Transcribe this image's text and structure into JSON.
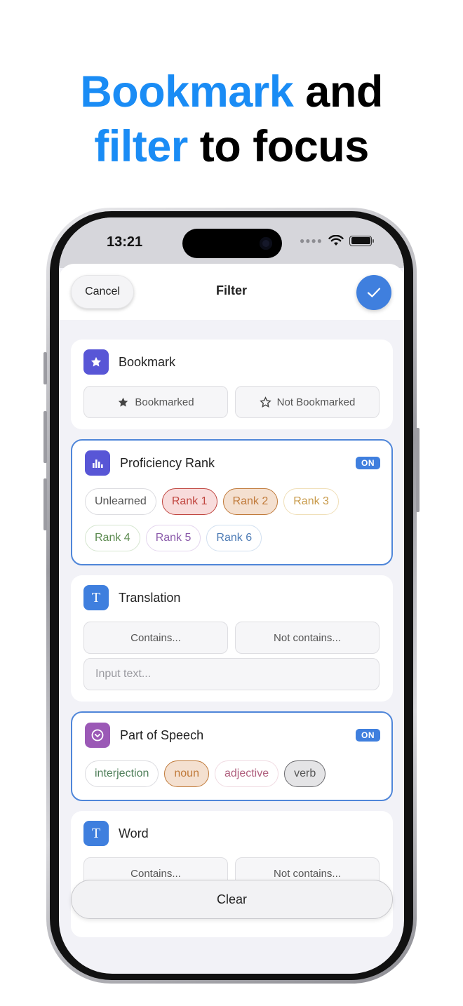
{
  "headline": {
    "line1_accent": "Bookmark",
    "line1_rest": " and",
    "line2_accent": "filter",
    "line2_rest": " to focus",
    "accent_color": "#1a8cf5"
  },
  "status_bar": {
    "time": "13:21",
    "icons": [
      "cellular-dots-icon",
      "wifi-icon",
      "battery-icon"
    ]
  },
  "header": {
    "cancel_label": "Cancel",
    "title": "Filter",
    "confirm_icon": "checkmark-icon"
  },
  "bookmark": {
    "title": "Bookmark",
    "icon": "star-icon",
    "options": [
      {
        "icon": "star-filled-icon",
        "label": "Bookmarked"
      },
      {
        "icon": "star-outline-icon",
        "label": "Not Bookmarked"
      }
    ]
  },
  "proficiency": {
    "title": "Proficiency Rank",
    "icon": "bar-chart-icon",
    "badge": "ON",
    "chips": [
      "Unlearned",
      "Rank 1",
      "Rank 2",
      "Rank 3",
      "Rank 4",
      "Rank 5",
      "Rank 6"
    ]
  },
  "translation": {
    "title": "Translation",
    "icon": "text-t-icon",
    "contains_label": "Contains...",
    "not_contains_label": "Not contains...",
    "input_placeholder": "Input text..."
  },
  "part_of_speech": {
    "title": "Part of Speech",
    "icon": "chevron-circle-icon",
    "badge": "ON",
    "chips": [
      "interjection",
      "noun",
      "adjective",
      "verb"
    ]
  },
  "word": {
    "title": "Word",
    "icon": "text-t-icon",
    "contains_label": "Contains...",
    "not_contains_label": "Not contains..."
  },
  "footer": {
    "clear_label": "Clear"
  },
  "colors": {
    "blue_accent": "#3f7fde",
    "bookmark_icon_bg": "#5856d6",
    "proficiency_icon_bg": "#5856d6",
    "text_icon_bg": "#3f7fde",
    "pos_icon_bg": "#9b59b6"
  }
}
